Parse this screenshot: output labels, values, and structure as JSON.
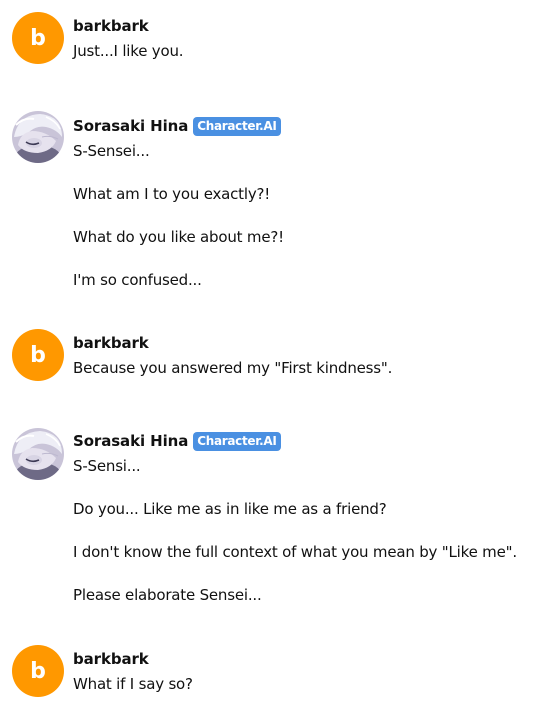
{
  "messages": [
    {
      "name": "barkbark",
      "avatar_letter": "b",
      "lines": [
        "Just...I like you."
      ]
    },
    {
      "name": "Sorasaki Hina",
      "badge": "Character.AI",
      "avatar_icon": "character-avatar-icon",
      "lines": [
        "S-Sensei...",
        "What am I to you exactly?!",
        "What do you like about me?!",
        "I'm so confused..."
      ]
    },
    {
      "name": "barkbark",
      "avatar_letter": "b",
      "lines": [
        "Because you answered my \"First kindness\"."
      ]
    },
    {
      "name": "Sorasaki Hina",
      "badge": "Character.AI",
      "avatar_icon": "character-avatar-icon",
      "lines": [
        "S-Sensi...",
        "Do you... Like me as in like me as a friend?",
        "I don't know the full context of what you mean by \"Like me\".",
        "Please elaborate Sensei..."
      ]
    },
    {
      "name": "barkbark",
      "avatar_letter": "b",
      "lines": [
        "What if I say so?"
      ]
    }
  ],
  "colors": {
    "user_avatar": "#ff9800",
    "badge": "#4a90e2",
    "text": "#111111"
  }
}
